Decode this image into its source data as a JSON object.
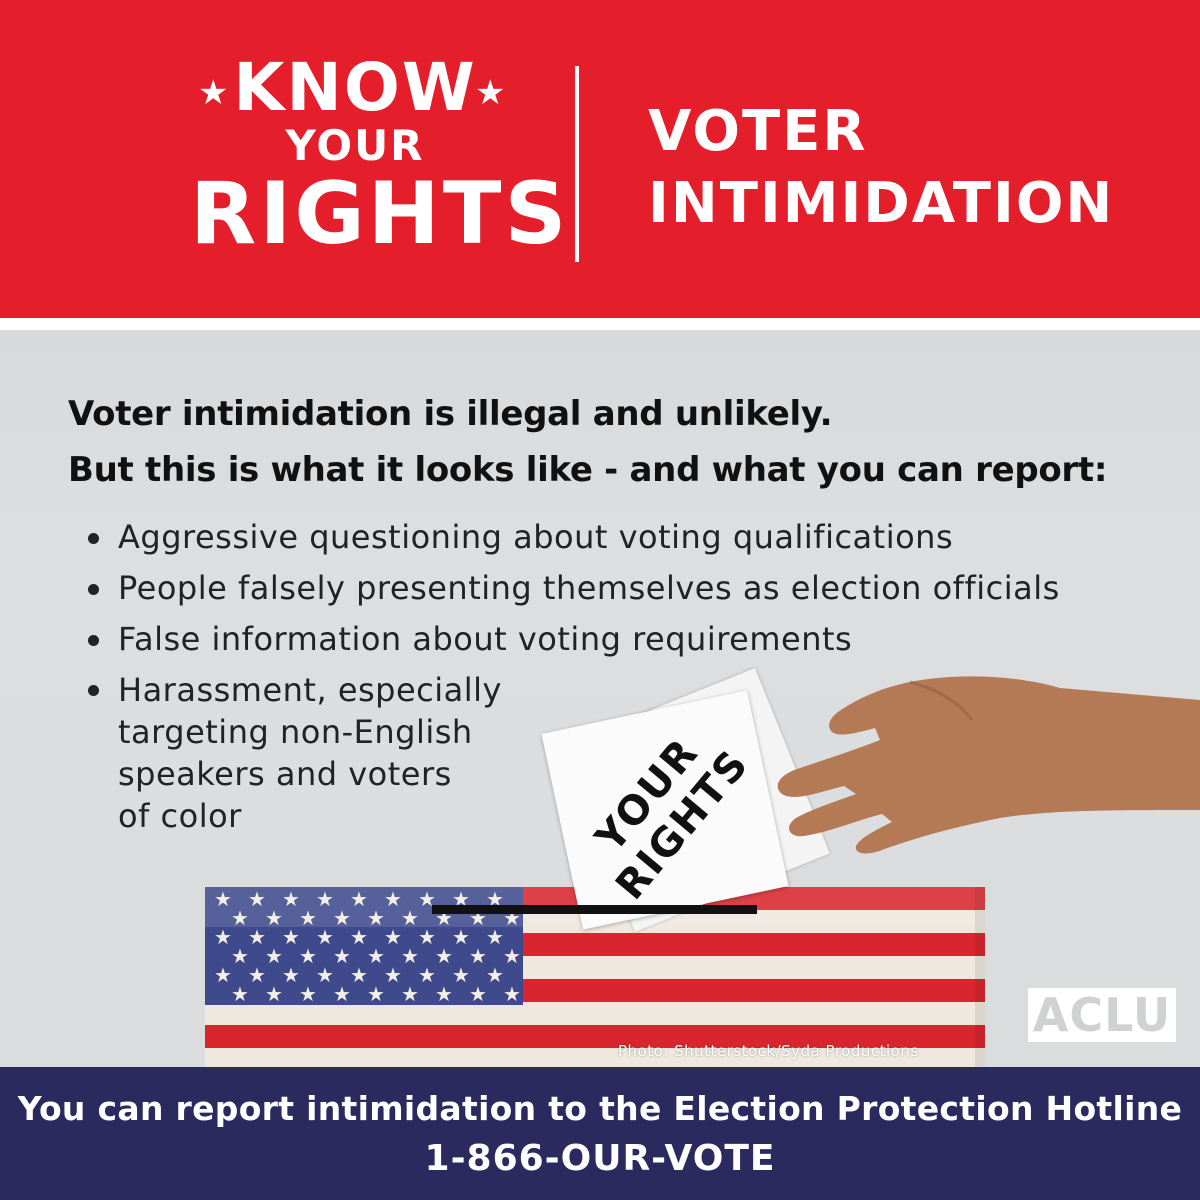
{
  "header": {
    "badge": {
      "line1": "KNOW",
      "line2": "YOUR",
      "line3": "RIGHTS",
      "star": "★"
    },
    "title_line1": "VOTER",
    "title_line2": "INTIMIDATION"
  },
  "lead": {
    "line1": "Voter intimidation is illegal and unlikely.",
    "line2": "But this is what it looks like - and what you can report:"
  },
  "bullets": [
    "Aggressive questioning about voting qualifications",
    "People falsely presenting themselves as election officials",
    "False information about voting requirements",
    [
      "Harassment, especially",
      "targeting non-English",
      "speakers and voters",
      "of color"
    ]
  ],
  "ballot": {
    "line1": "YOUR",
    "line2": "RIGHTS"
  },
  "logo": "ACLU",
  "photo_credit": "Photo: Shutterstock/Syda Productions",
  "footer": {
    "line1": "You can report intimidation to the Election Protection Hotline",
    "line2": "1-866-OUR-VOTE"
  },
  "colors": {
    "header_red": "#e41f2b",
    "footer_navy": "#2a2a5e",
    "flag_blue": "#3f4a8c",
    "flag_red": "#d9262e"
  },
  "icons": [
    "star-icon",
    "ballot-box",
    "hand-icon",
    "aclu-logo"
  ]
}
